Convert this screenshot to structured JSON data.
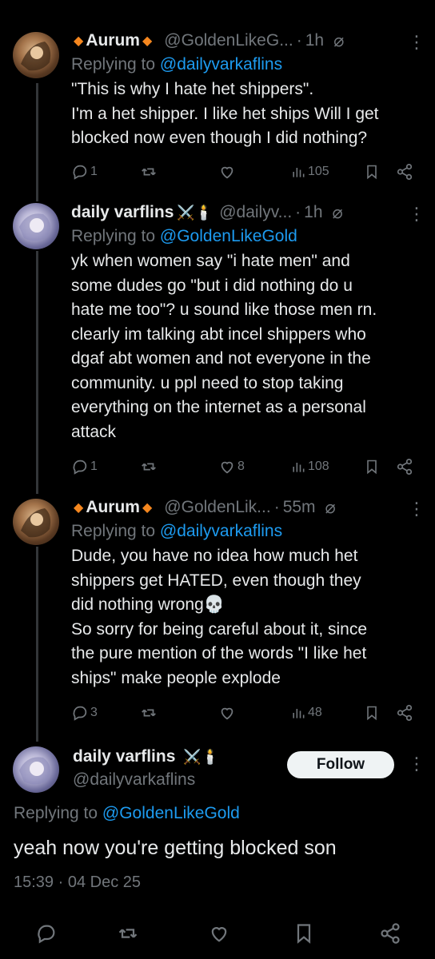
{
  "tweets": [
    {
      "name": "Aurum",
      "handle": "@GoldenLikeG...",
      "dot": "·",
      "time": "1h",
      "replying_prefix": "Replying to ",
      "replying_to": "@dailyvarkaflins",
      "lines": [
        "\"This is why I hate het shippers\".",
        "I'm a het shipper. I like het ships Will I get",
        "blocked now even though I did nothing?"
      ],
      "replies": "1",
      "reposts": "",
      "likes": "",
      "views": "105"
    },
    {
      "name": "daily varflins",
      "badge": "⚔️🕯️",
      "handle": "@dailyv...",
      "dot": "·",
      "time": "1h",
      "replying_prefix": "Replying to ",
      "replying_to": "@GoldenLikeGold",
      "lines": [
        "yk when women say \"i hate men\" and",
        "some dudes go \"but i did nothing do u",
        "hate me too\"? u sound like those men rn.",
        "clearly im talking abt incel shippers who",
        "dgaf abt women and not everyone in the",
        "community. u ppl need to stop taking",
        "everything on the internet as a personal",
        "attack"
      ],
      "replies": "1",
      "reposts": "",
      "likes": "8",
      "views": "108"
    },
    {
      "name": "Aurum",
      "handle": "@GoldenLik...",
      "dot": "·",
      "time": "55m",
      "replying_prefix": "Replying to ",
      "replying_to": "@dailyvarkaflins",
      "lines": [
        "Dude, you have no idea how much het",
        "shippers get HATED, even though they",
        "did nothing wrong💀",
        "So sorry for being careful about it, since",
        "the pure mention of the words \"I like het",
        "ships\" make people explode"
      ],
      "replies": "3",
      "reposts": "",
      "likes": "",
      "views": "48"
    }
  ],
  "main": {
    "name": "daily varflins",
    "badge": "⚔️🕯️",
    "handle": "@dailyvarkaflins",
    "follow_label": "Follow",
    "replying_prefix": "Replying to ",
    "replying_to": "@GoldenLikeGold",
    "text": "yeah now you're getting blocked son",
    "timestamp": "15:39 · 04 Dec 25"
  },
  "colors": {
    "accent": "#1d9bf0",
    "muted": "#71767b",
    "text": "#e7e9ea",
    "bg": "#000000",
    "diamond": "#f5871f"
  },
  "icons": [
    "reply-icon",
    "repost-icon",
    "like-icon",
    "views-icon",
    "bookmark-icon",
    "share-icon",
    "grok-icon",
    "more-icon"
  ]
}
